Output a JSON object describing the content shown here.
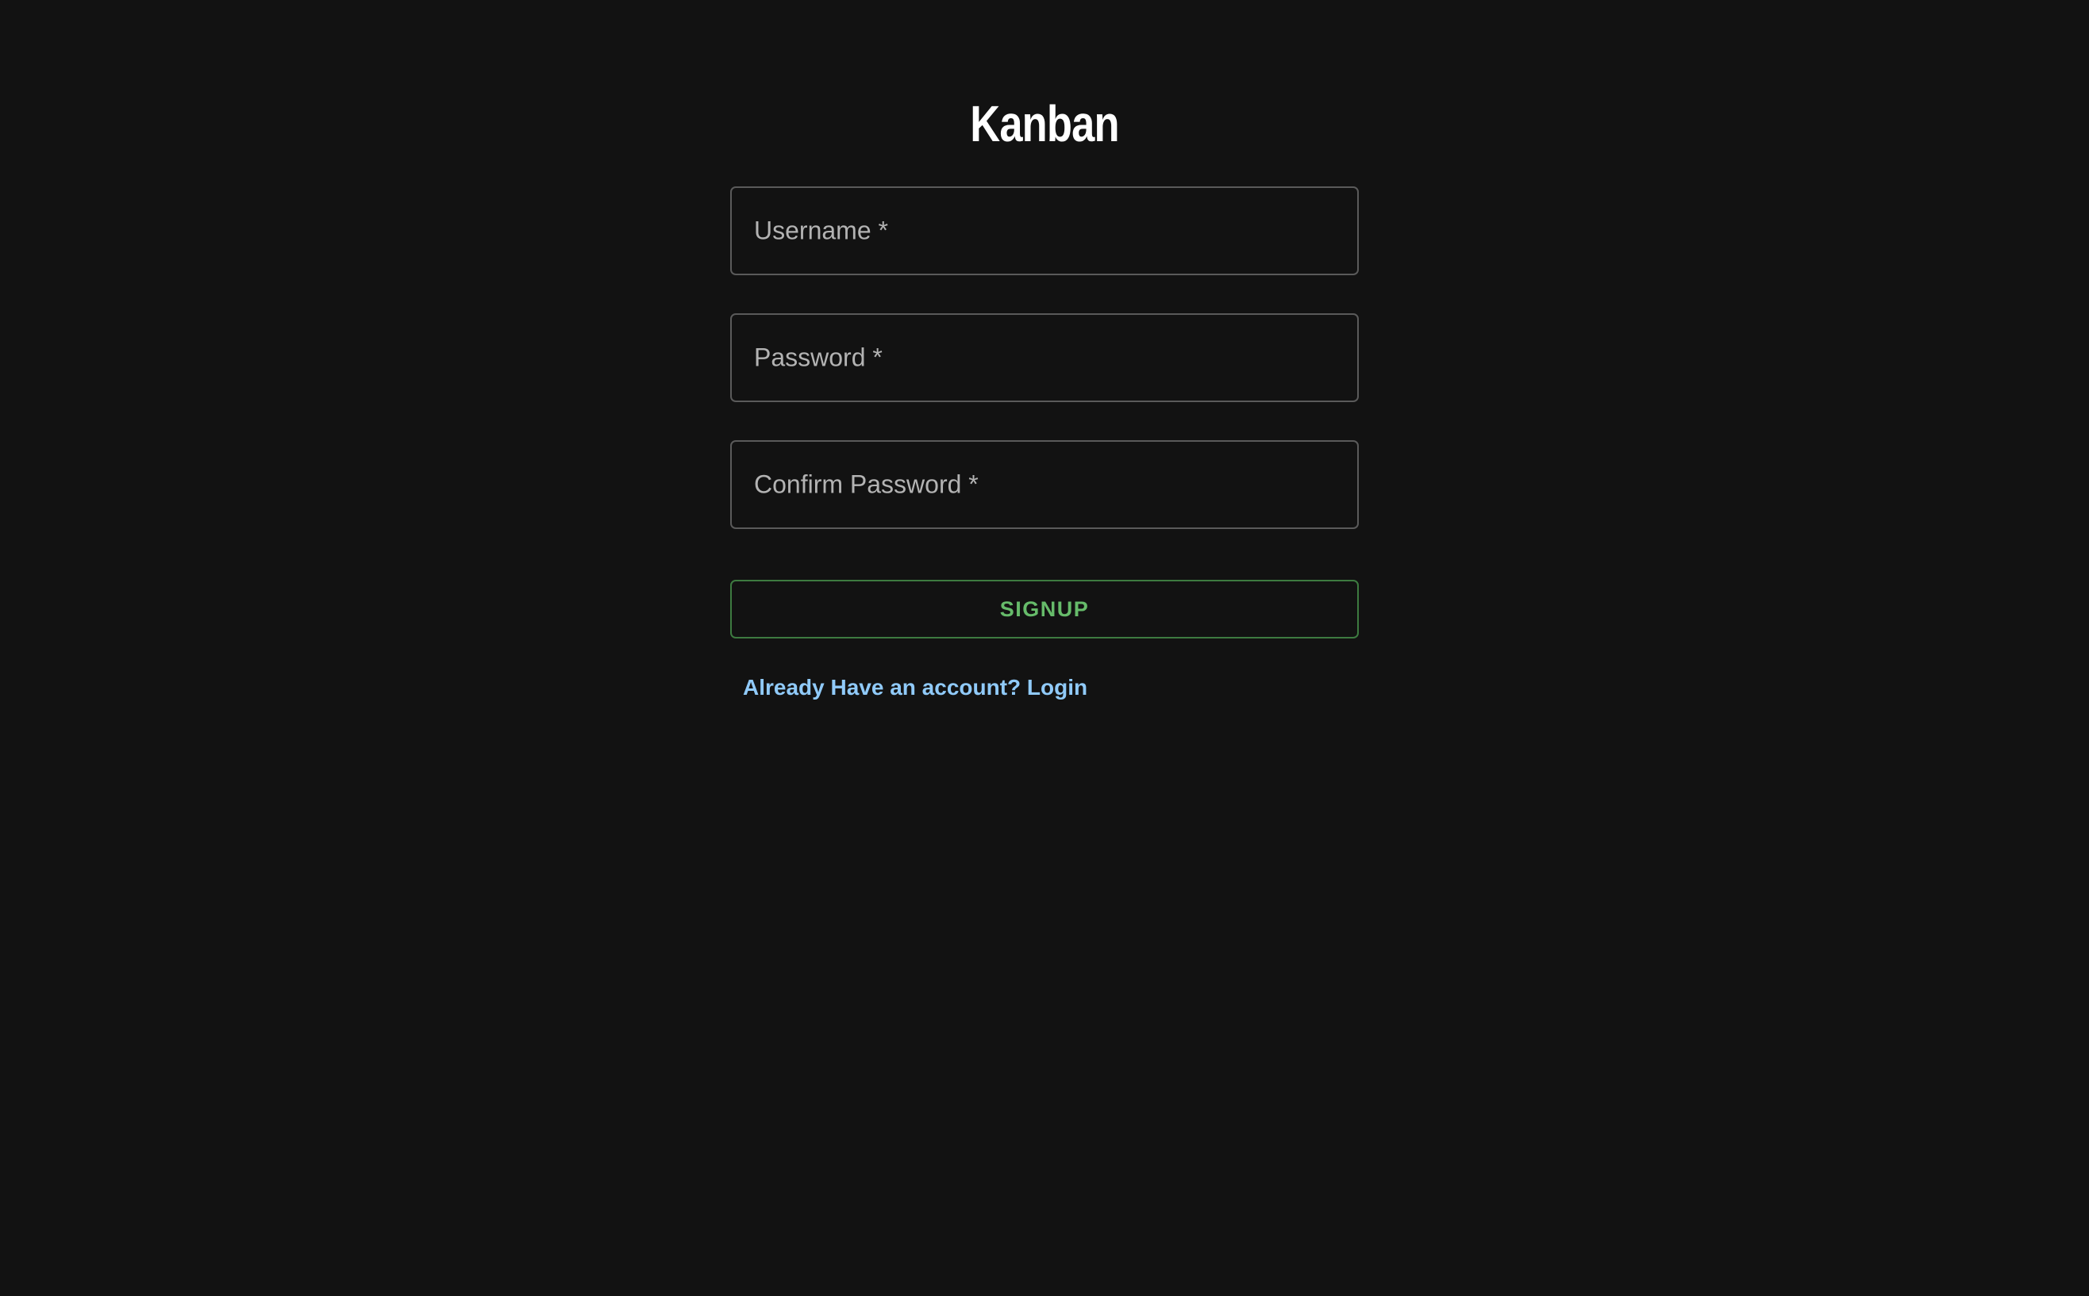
{
  "app": {
    "title": "Kanban"
  },
  "form": {
    "username": {
      "label": "Username *",
      "value": ""
    },
    "password": {
      "label": "Password *",
      "value": ""
    },
    "confirm_password": {
      "label": "Confirm Password *",
      "value": ""
    },
    "submit_label": "SIGNUP",
    "login_link_label": "Already Have an account? Login"
  },
  "colors": {
    "background": "#121212",
    "title": "#ffffff",
    "field_border": "#5a5a5a",
    "field_label": "#b3b3b3",
    "signup_text": "#66bb6a",
    "signup_border": "#3d7a40",
    "link": "#90caf9"
  }
}
